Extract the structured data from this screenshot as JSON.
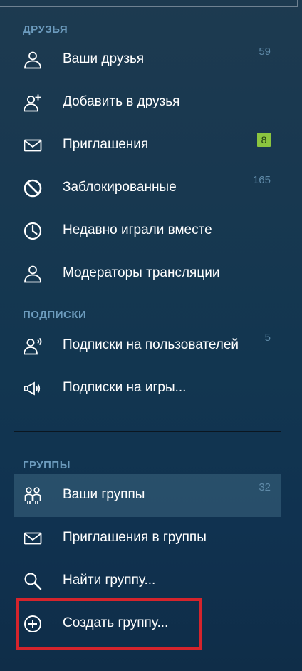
{
  "sections": {
    "friends": {
      "header": "ДРУЗЬЯ",
      "items": [
        {
          "label": "Ваши друзья",
          "count": "59"
        },
        {
          "label": "Добавить в друзья"
        },
        {
          "label": "Приглашения",
          "badge": "8"
        },
        {
          "label": "Заблокированные",
          "count": "165"
        },
        {
          "label": "Недавно играли вместе"
        },
        {
          "label": "Модераторы трансляции"
        }
      ]
    },
    "follows": {
      "header": "ПОДПИСКИ",
      "items": [
        {
          "label": "Подписки на пользователей",
          "count": "5"
        },
        {
          "label": "Подписки на игры..."
        }
      ]
    },
    "groups": {
      "header": "ГРУППЫ",
      "items": [
        {
          "label": "Ваши группы",
          "count": "32",
          "active": true
        },
        {
          "label": "Приглашения в группы"
        },
        {
          "label": "Найти группу..."
        },
        {
          "label": "Создать группу...",
          "highlighted": true
        }
      ]
    }
  },
  "icons": {
    "friends": [
      "user-icon",
      "add-friend-icon",
      "envelope-icon",
      "blocked-icon",
      "clock-icon",
      "user-icon"
    ],
    "follows": [
      "user-follow-icon",
      "megaphone-icon"
    ],
    "groups": [
      "group-icon",
      "envelope-icon",
      "search-icon",
      "plus-circle-icon"
    ]
  },
  "colors": {
    "section_header": "#6c9bbd",
    "count": "#5f8aa8",
    "badge": "#8bc53f",
    "highlight_box": "#d5242c"
  }
}
